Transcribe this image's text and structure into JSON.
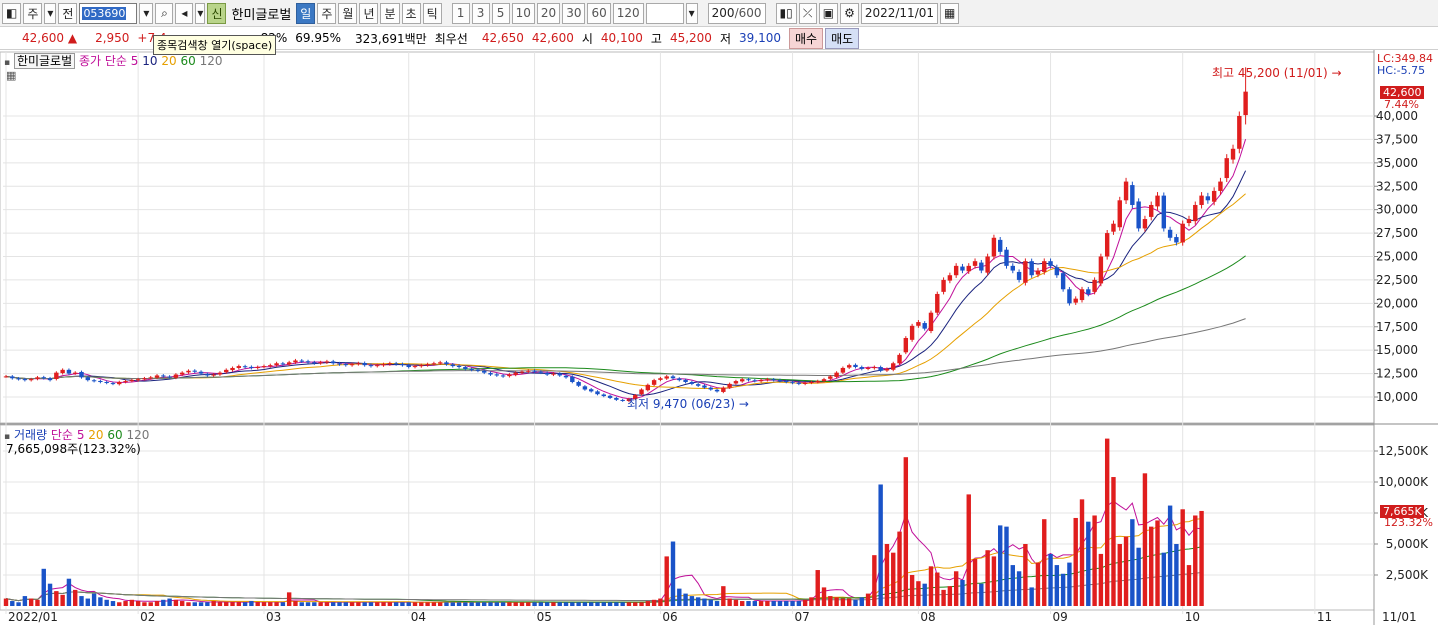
{
  "toolbar": {
    "period_menu": "주",
    "prev_label": "전",
    "stock_code": "053690",
    "info_badge": "신",
    "stock_name": "한미글로벌",
    "period_tabs": [
      "일",
      "주",
      "월",
      "년",
      "분",
      "초",
      "틱"
    ],
    "active_period": "일",
    "intervals": [
      "1",
      "3",
      "5",
      "10",
      "20",
      "30",
      "60",
      "120"
    ],
    "count_value": "200",
    "count_max": "/600",
    "date_value": "2022/11/01"
  },
  "quote": {
    "price": "42,600",
    "arrow": "▲",
    "change": "2,950",
    "change_pct": "+7.4",
    "rate_frag": "82%",
    "turnover": "69.95%",
    "amount": "323,691백만",
    "best_label": "최우선",
    "best_ask": "42,650",
    "best_bid": "42,600",
    "open_label": "시",
    "open": "40,100",
    "high_label": "고",
    "high": "45,200",
    "low_label": "저",
    "low": "39,100",
    "buy_label": "매수",
    "sell_label": "매도"
  },
  "tooltip": "종목검색창 열기(space)",
  "price_panel": {
    "name_tab": "한미글로벌",
    "legend_prefix": "종가 단순",
    "ma_labels": [
      "5",
      "10",
      "20",
      "60",
      "120"
    ],
    "ma_colors": [
      "#c0109a",
      "#1a237e",
      "#e6a000",
      "#1b8a1b",
      "#777777"
    ],
    "lc_label": "LC:349.84",
    "hc_label": "HC:-5.75",
    "current_tag": "42,600",
    "current_pct": "7.44%",
    "high_annotation": "최고 45,200 (11/01)",
    "low_annotation": "최저 9,470 (06/23)"
  },
  "volume_panel": {
    "legend_name": "거래량",
    "legend_prefix": "단순",
    "ma_labels": [
      "5",
      "20",
      "60",
      "120"
    ],
    "value_line": "7,665,098주(123.32%)",
    "current_tag": "7,665K",
    "current_pct": "123.32%"
  },
  "chart_data": {
    "type": "candlestick",
    "price_axis_ticks": [
      "10,000",
      "12,500",
      "15,000",
      "17,500",
      "20,000",
      "22,500",
      "25,000",
      "27,500",
      "30,000",
      "32,500",
      "35,000",
      "37,500",
      "40,000"
    ],
    "price_ylim": [
      8000,
      49000
    ],
    "volume_axis_ticks": [
      "2,500K",
      "5,000K",
      "7,500K",
      "10,000K",
      "12,500K"
    ],
    "volume_ylim": [
      0,
      14500
    ],
    "x_labels": [
      "2022/01",
      "02",
      "03",
      "04",
      "05",
      "06",
      "07",
      "08",
      "09",
      "10",
      "11",
      "11/01"
    ],
    "x_label_days": [
      0,
      21,
      41,
      64,
      84,
      104,
      125,
      145,
      166,
      187,
      208,
      212
    ],
    "candle_count": 210,
    "series_note": "daily closes approximated from the screenshot",
    "closes": [
      12200,
      12000,
      11900,
      11800,
      11900,
      12100,
      12000,
      11800,
      12600,
      12900,
      12500,
      12600,
      12100,
      11800,
      11700,
      11600,
      11500,
      11400,
      11600,
      11700,
      11800,
      11900,
      12000,
      12100,
      12300,
      12200,
      12100,
      12400,
      12600,
      12800,
      12700,
      12500,
      12300,
      12400,
      12600,
      12900,
      13100,
      13300,
      13200,
      13100,
      13200,
      13300,
      13400,
      13600,
      13500,
      13700,
      13900,
      13800,
      13700,
      13600,
      13700,
      13800,
      13600,
      13500,
      13400,
      13500,
      13600,
      13400,
      13300,
      13400,
      13500,
      13600,
      13500,
      13400,
      13200,
      13300,
      13400,
      13500,
      13600,
      13700,
      13500,
      13300,
      13200,
      13000,
      12900,
      12800,
      12600,
      12400,
      12300,
      12200,
      12400,
      12600,
      12700,
      12800,
      12700,
      12600,
      12400,
      12500,
      12300,
      12100,
      11600,
      11200,
      10800,
      10600,
      10300,
      10100,
      9900,
      9700,
      9600,
      9800,
      10200,
      10800,
      11300,
      11800,
      12000,
      12200,
      12000,
      11800,
      11600,
      11400,
      11200,
      11000,
      10800,
      10600,
      11000,
      11400,
      11700,
      11900,
      11800,
      11700,
      11800,
      11900,
      11800,
      11700,
      11600,
      11500,
      11400,
      11500,
      11600,
      11700,
      11900,
      12200,
      12600,
      13100,
      13400,
      13200,
      13000,
      13100,
      13200,
      12800,
      13000,
      13600,
      14500,
      16300,
      17600,
      18000,
      17300,
      19000,
      21000,
      22500,
      23000,
      24000,
      23500,
      24000,
      24500,
      23500,
      25000,
      27000,
      25500,
      24000,
      23500,
      22500,
      24500,
      23000,
      23500,
      24500,
      24000,
      23000,
      21500,
      20000,
      20500,
      21500,
      21000,
      22500,
      25000,
      27500,
      28500,
      31000,
      33000,
      30500,
      28000,
      29000,
      30500,
      31500,
      28000,
      27000,
      26500,
      28500,
      29000,
      30500,
      31500,
      31000,
      32000,
      33000,
      35500,
      36500,
      40000,
      42600
    ],
    "volumes": [
      600,
      400,
      300,
      800,
      600,
      500,
      3000,
      1800,
      1200,
      900,
      2200,
      1300,
      800,
      600,
      1000,
      700,
      500,
      400,
      300,
      400,
      500,
      400,
      300,
      300,
      400,
      500,
      600,
      500,
      400,
      300,
      300,
      300,
      300,
      400,
      300,
      300,
      300,
      300,
      300,
      400,
      300,
      300,
      300,
      300,
      300,
      1100,
      400,
      300,
      300,
      300,
      300,
      300,
      300,
      300,
      300,
      300,
      300,
      300,
      300,
      300,
      300,
      300,
      300,
      300,
      300,
      300,
      300,
      300,
      300,
      300,
      300,
      300,
      300,
      300,
      300,
      300,
      300,
      300,
      300,
      300,
      300,
      300,
      300,
      300,
      300,
      300,
      300,
      300,
      300,
      300,
      300,
      300,
      300,
      300,
      300,
      300,
      300,
      300,
      300,
      300,
      300,
      300,
      400,
      500,
      600,
      4000,
      5200,
      1400,
      1000,
      800,
      700,
      600,
      500,
      400,
      1600,
      600,
      500,
      400,
      400,
      400,
      400,
      400,
      400,
      400,
      400,
      400,
      400,
      500,
      700,
      2900,
      1500,
      800,
      700,
      600,
      600,
      500,
      700,
      1000,
      4100,
      9800,
      5000,
      4300,
      6000,
      12000,
      2500,
      2000,
      1800,
      3200,
      2700,
      1300,
      1600,
      2800,
      2100,
      9000,
      3800,
      1800,
      4500,
      4000,
      6500,
      6400,
      3300,
      2800,
      5000,
      1500,
      3500,
      7000,
      4200,
      3300,
      2600,
      3500,
      7100,
      8600,
      6800,
      7300,
      4200,
      13500,
      10400,
      5000,
      5600,
      7000,
      4700,
      10700,
      6400,
      6900,
      4300,
      8100,
      5000,
      7800,
      3300,
      7300,
      7665
    ],
    "ma5": [],
    "ma10": [],
    "ma20": [],
    "ma60": [],
    "ma120": []
  }
}
